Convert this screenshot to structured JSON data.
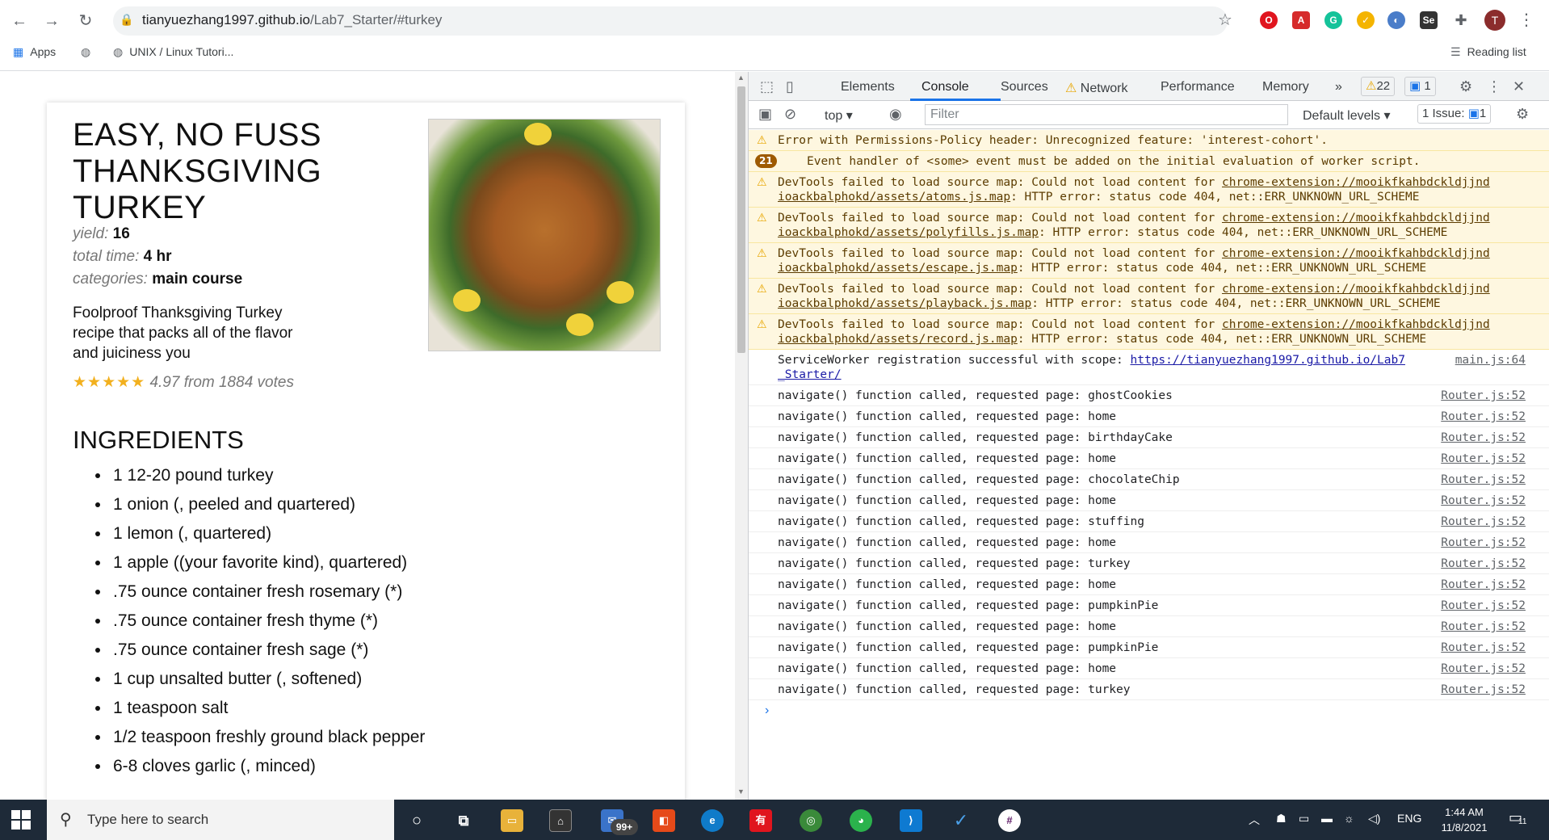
{
  "browser": {
    "url_host": "tianyuezhang1997.github.io",
    "url_path": "/Lab7_Starter/#turkey",
    "bookmarks": [
      "Apps",
      "UNIX / Linux Tutori..."
    ],
    "reading_list": "Reading list",
    "avatar_letter": "T"
  },
  "recipe": {
    "title": "EASY, NO FUSS THANKSGIVING TURKEY",
    "yield_label": "yield:",
    "yield": "16",
    "time_label": "total time:",
    "time": "4 hr",
    "categories_label": "categories:",
    "categories": "main course",
    "description": "Foolproof Thanksgiving Turkey recipe that packs all of the flavor and juiciness you",
    "stars": "★★★★★",
    "rating_text": "4.97 from 1884 votes",
    "ingredients_heading": "INGREDIENTS",
    "ingredients": [
      "1 12-20 pound turkey",
      "1 onion (, peeled and quartered)",
      "1 lemon (, quartered)",
      "1 apple ((your favorite kind), quartered)",
      ".75 ounce container fresh rosemary (*)",
      ".75 ounce container fresh thyme (*)",
      ".75 ounce container fresh sage (*)",
      "1 cup unsalted butter (, softened)",
      "1 teaspoon salt",
      "1/2 teaspoon freshly ground black pepper",
      "6-8 cloves garlic (, minced)"
    ]
  },
  "devtools": {
    "tabs": [
      "Elements",
      "Console",
      "Sources",
      "Network",
      "Performance",
      "Memory"
    ],
    "active_tab": "Console",
    "warn_count": "22",
    "msg_count": "1",
    "context": "top",
    "filter_placeholder": "Filter",
    "levels": "Default levels",
    "issues_label": "1 Issue:",
    "issues_count": "1",
    "messages": [
      {
        "kind": "warn",
        "text": "Error with Permissions-Policy header: Unrecognized feature: 'interest-cohort'."
      },
      {
        "kind": "group",
        "count": "21",
        "text": "Event handler of <some> event must be added on the initial evaluation of worker script."
      },
      {
        "kind": "warn",
        "pre": "DevTools failed to load source map: Could not load content for ",
        "link": "chrome-extension://mooikfkahbdckldjjnd ioackbalphokd/assets/atoms.js.map",
        "post": ": HTTP error: status code 404, net::ERR_UNKNOWN_URL_SCHEME"
      },
      {
        "kind": "warn",
        "pre": "DevTools failed to load source map: Could not load content for ",
        "link": "chrome-extension://mooikfkahbdckldjjnd ioackbalphokd/assets/polyfills.js.map",
        "post": ": HTTP error: status code 404, net::ERR_UNKNOWN_URL_SCHEME"
      },
      {
        "kind": "warn",
        "pre": "DevTools failed to load source map: Could not load content for ",
        "link": "chrome-extension://mooikfkahbdckldjjnd ioackbalphokd/assets/escape.js.map",
        "post": ": HTTP error: status code 404, net::ERR_UNKNOWN_URL_SCHEME"
      },
      {
        "kind": "warn",
        "pre": "DevTools failed to load source map: Could not load content for ",
        "link": "chrome-extension://mooikfkahbdckldjjnd ioackbalphokd/assets/playback.js.map",
        "post": ": HTTP error: status code 404, net::ERR_UNKNOWN_URL_SCHEME"
      },
      {
        "kind": "warn",
        "pre": "DevTools failed to load source map: Could not load content for ",
        "link": "chrome-extension://mooikfkahbdckldjjnd ioackbalphokd/assets/record.js.map",
        "post": ": HTTP error: status code 404, net::ERR_UNKNOWN_URL_SCHEME"
      },
      {
        "kind": "log",
        "text": "ServiceWorker registration successful with scope: ",
        "link": "https://tianyuezhang1997.github.io/Lab7 _Starter/",
        "src": "main.js:64"
      },
      {
        "kind": "log",
        "text": "navigate() function called, requested page: ghostCookies",
        "src": "Router.js:52"
      },
      {
        "kind": "log",
        "text": "navigate() function called, requested page: home",
        "src": "Router.js:52"
      },
      {
        "kind": "log",
        "text": "navigate() function called, requested page: birthdayCake",
        "src": "Router.js:52"
      },
      {
        "kind": "log",
        "text": "navigate() function called, requested page: home",
        "src": "Router.js:52"
      },
      {
        "kind": "log",
        "text": "navigate() function called, requested page: chocolateChip",
        "src": "Router.js:52"
      },
      {
        "kind": "log",
        "text": "navigate() function called, requested page: home",
        "src": "Router.js:52"
      },
      {
        "kind": "log",
        "text": "navigate() function called, requested page: stuffing",
        "src": "Router.js:52"
      },
      {
        "kind": "log",
        "text": "navigate() function called, requested page: home",
        "src": "Router.js:52"
      },
      {
        "kind": "log",
        "text": "navigate() function called, requested page: turkey",
        "src": "Router.js:52"
      },
      {
        "kind": "log",
        "text": "navigate() function called, requested page: home",
        "src": "Router.js:52"
      },
      {
        "kind": "log",
        "text": "navigate() function called, requested page: pumpkinPie",
        "src": "Router.js:52"
      },
      {
        "kind": "log",
        "text": "navigate() function called, requested page: home",
        "src": "Router.js:52"
      },
      {
        "kind": "log",
        "text": "navigate() function called, requested page: pumpkinPie",
        "src": "Router.js:52"
      },
      {
        "kind": "log",
        "text": "navigate() function called, requested page: home",
        "src": "Router.js:52"
      },
      {
        "kind": "log",
        "text": "navigate() function called, requested page: turkey",
        "src": "Router.js:52"
      }
    ]
  },
  "taskbar": {
    "search_placeholder": "Type here to search",
    "mail_badge": "99+",
    "lang": "ENG",
    "time": "1:44 AM",
    "date": "11/8/2021",
    "notif_count": "11"
  }
}
